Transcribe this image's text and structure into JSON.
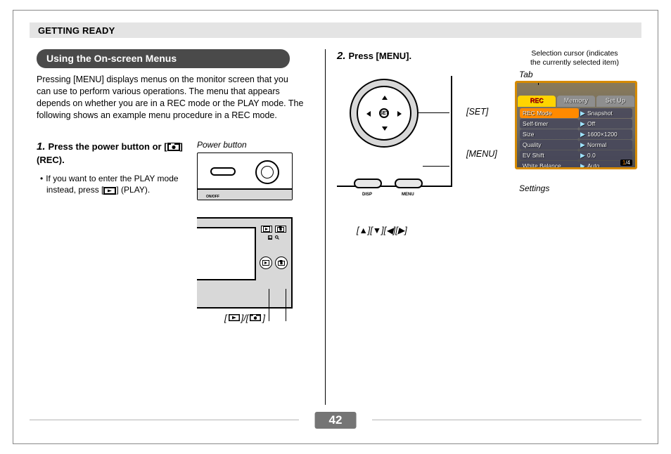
{
  "header": {
    "section": "GETTING READY"
  },
  "page_number": "42",
  "left": {
    "heading": "Using the On-screen Menus",
    "intro": "Pressing [MENU] displays menus on the monitor screen that you can use to perform various operations. The menu that appears depends on whether you are in a REC mode or the PLAY mode. The following shows an example menu procedure in a REC mode.",
    "step1_num": "1.",
    "step1_title_a": "Press the power button or [",
    "step1_title_b": "] (REC).",
    "power_caption": "Power button",
    "note_bullet": "•",
    "note_a": "If you want to enter the PLAY mode instead, press [",
    "note_b": "] (PLAY).",
    "back_icons_caption": "[     ]/[     ]"
  },
  "right": {
    "step2_num": "2.",
    "step2_title": "Press [MENU].",
    "set_label": "[SET]",
    "menu_label": "[MENU]",
    "arrows_label": "[▲][▼][◀][▶]",
    "cursor_note_l1": "Selection cursor (indicates",
    "cursor_note_l2": "the currently selected item)",
    "tab_label": "Tab",
    "settings_label": "Settings",
    "lcd": {
      "tabs": [
        {
          "label": "REC",
          "active": true
        },
        {
          "label": "Memory",
          "active": false
        },
        {
          "label": "Set Up",
          "active": false
        }
      ],
      "rows": [
        {
          "k": "REC Mode",
          "v": "Snapshot",
          "selected": true
        },
        {
          "k": "Self-timer",
          "v": "Off",
          "selected": false
        },
        {
          "k": "Size",
          "v": "1600×1200",
          "selected": false
        },
        {
          "k": "Quality",
          "v": "Normal",
          "selected": false
        },
        {
          "k": "EV Shift",
          "v": "0.0",
          "selected": false
        },
        {
          "k": "White Balance",
          "v": "Auto",
          "selected": false
        }
      ],
      "page_current": "1",
      "page_total": "/4"
    }
  }
}
